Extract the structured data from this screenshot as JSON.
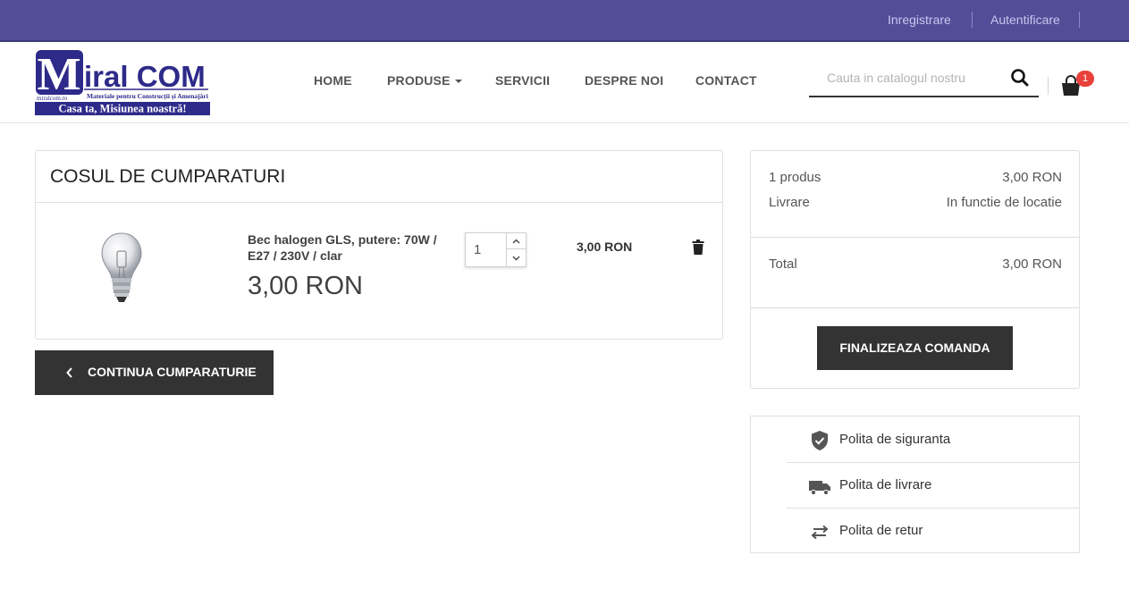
{
  "topbar": {
    "register_label": "Inregistrare",
    "login_label": "Autentificare"
  },
  "logo": {
    "brand": "Miral COM",
    "domain": "miralcom.ro",
    "tagline": "Materiale pentru Construcții și Amenajări",
    "slogan": "Casa ta, Misiunea noastră!"
  },
  "nav": {
    "items": [
      {
        "label": "HOME"
      },
      {
        "label": "PRODUSE"
      },
      {
        "label": "SERVICII"
      },
      {
        "label": "DESPRE NOI"
      },
      {
        "label": "CONTACT"
      }
    ]
  },
  "search": {
    "placeholder": "Cauta in catalogul nostru",
    "icon": "search-icon"
  },
  "cart_icon": {
    "icon": "shopping-bag-icon",
    "count": "1"
  },
  "cart": {
    "title": "COSUL DE CUMPARATURI",
    "items": [
      {
        "name": "Bec halogen GLS, putere: 70W / E27 / 230V / clar",
        "unit_price": "3,00 RON",
        "quantity": "1",
        "line_total": "3,00 RON",
        "image_icon": "light-bulb-image"
      }
    ],
    "continue_label": "CONTINUA CUMPARATURIE"
  },
  "summary": {
    "products_label": "1 produs",
    "products_value": "3,00 RON",
    "shipping_label": "Livrare",
    "shipping_value": "In functie de locatie",
    "total_label": "Total",
    "total_value": "3,00 RON",
    "checkout_label": "FINALIZEAZA COMANDA"
  },
  "policies": [
    {
      "label": "Polita de siguranta",
      "icon": "shield-check-icon"
    },
    {
      "label": "Polita de livrare",
      "icon": "truck-icon"
    },
    {
      "label": "Polita de retur",
      "icon": "swap-arrows-icon"
    }
  ],
  "colors": {
    "topbar": "#524d96",
    "logo_blue": "#2e2a8a",
    "button_dark": "#333333",
    "badge_red": "#e8413b"
  }
}
